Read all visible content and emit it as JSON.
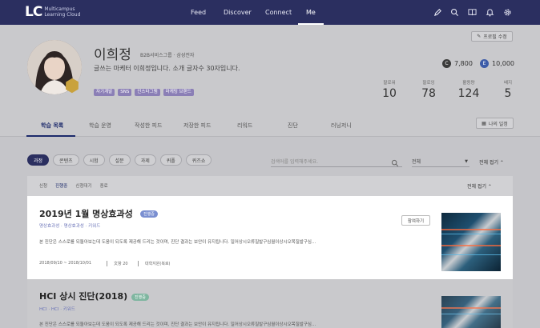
{
  "brand": {
    "mark": "LC",
    "text": "Multicampus Learning Cloud"
  },
  "nav": {
    "items": [
      "Feed",
      "Discover",
      "Connect",
      "Me"
    ],
    "active": "Me"
  },
  "top_icons": [
    "pencil-icon",
    "search-icon",
    "book-icon",
    "bell-icon",
    "gear-icon"
  ],
  "profile": {
    "name": "이희정",
    "org": "B2B서비스그룹 · 삼성전자",
    "intro": "글쓰는 마케터 이희정입니다. 소개 글자수 30자입니다.",
    "tags": [
      "자기계발",
      "SNS",
      "인스타그램",
      "마케팅 브랜드"
    ],
    "edit_label": "프로필 수정",
    "coins": [
      {
        "symbol": "C",
        "value": "7,800",
        "color": "#3b3b3b"
      },
      {
        "symbol": "E",
        "value": "10,000",
        "color": "#3d5ca8"
      }
    ],
    "stats": [
      {
        "label": "팔로워",
        "value": "10"
      },
      {
        "label": "팔로잉",
        "value": "78"
      },
      {
        "label": "활동량",
        "value": "124"
      },
      {
        "label": "배지",
        "value": "5"
      }
    ]
  },
  "tabs": [
    "학습 목록",
    "학습 운영",
    "작성한 피드",
    "저장한 피드",
    "리워드",
    "진단",
    "러닝저니"
  ],
  "active_tab": "학습 목록",
  "calendar_label": "나의 일정",
  "filters": {
    "chips": [
      "과정",
      "콘텐츠",
      "시험",
      "설문",
      "과제",
      "퀴폴",
      "퀴즈쇼"
    ],
    "active": "과정"
  },
  "search": {
    "placeholder": "검색어를 입력해주세요."
  },
  "select": {
    "value": "전체"
  },
  "fold_label": "전체 접기",
  "subtabs": [
    "신청",
    "진행중",
    "신청대기",
    "종료"
  ],
  "subtabs_active": "진행중",
  "fold_label2": "전체 접기",
  "cards": [
    {
      "title": "2019년 1월 명상효과성",
      "status": "진행중",
      "meta": [
        "명상효과성",
        "명상효과성",
        "키워드"
      ],
      "desc": "본 진단은 스스로를 되돌아보는데 도움이 되도록 제공해 드리는 것이며, 진단 결과는 보안이 유지됩니다. 일어상시오류질발구심월이상시오목질발구심...",
      "period": "2018/09/10 ~ 2018/10/01",
      "count": "文항 20",
      "owner": "대학지원(복로)",
      "button": "참여하기"
    },
    {
      "title": "HCI 상시 진단(2018)",
      "status": "진행중",
      "meta": [
        "HCI",
        "HCI",
        "키워드"
      ],
      "desc": "본 진단은 스스로를 되돌아보는데 도움이 되도록 제공해 드리는 것이며, 진단 결과는 보안이 유지됩니다. 일어상시오류질발구심월이상시오목질발구심..."
    }
  ],
  "colors": {
    "navy": "#2b2f60",
    "accent": "#1c2a6b",
    "tag": "#8b7fb6",
    "status": "#7a8fd1"
  }
}
